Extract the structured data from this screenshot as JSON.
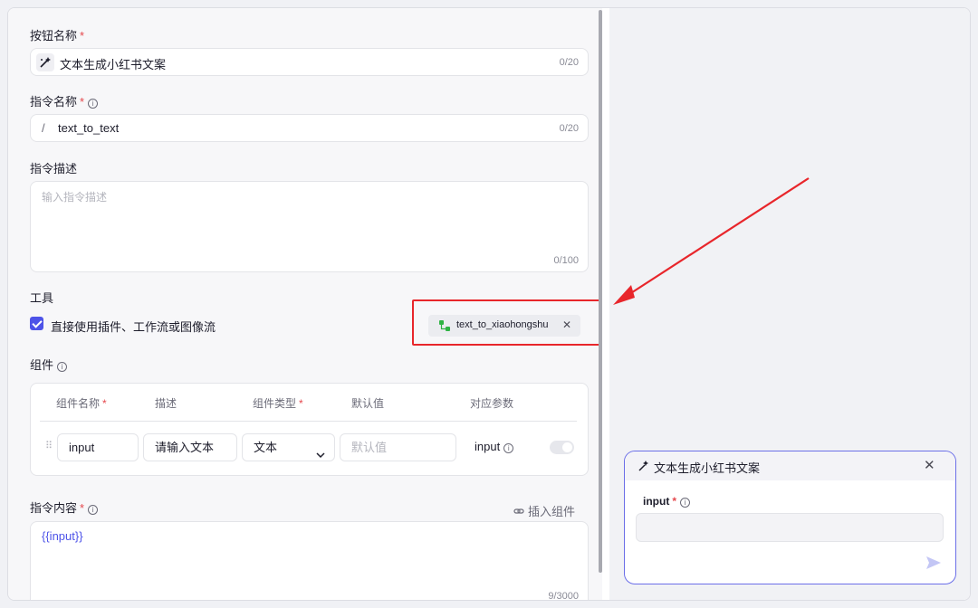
{
  "form": {
    "button_name": {
      "label": "按钮名称",
      "required_mark": "*",
      "value": "文本生成小红书文案",
      "counter": "0/20",
      "icon": "magic-wand-icon"
    },
    "command_name": {
      "label": "指令名称",
      "required_mark": "*",
      "info": "i",
      "prefix": "/",
      "value": "text_to_text",
      "counter": "0/20"
    },
    "command_desc": {
      "label": "指令描述",
      "placeholder": "输入指令描述",
      "counter": "0/100"
    },
    "tools": {
      "label": "工具",
      "checkbox_label": "直接使用插件、工作流或图像流",
      "checked": true,
      "chip_label": "text_to_xiaohongshu",
      "chip_icon": "workflow-icon",
      "chip_close": "✕"
    },
    "components": {
      "label": "组件",
      "info": "i",
      "headers": [
        "组件名称",
        "描述",
        "组件类型",
        "默认值",
        "对应参数"
      ],
      "required_mark": "*",
      "row": {
        "drag_handle": "⠿",
        "name": "input",
        "description": "请输入文本",
        "type": "文本",
        "default_placeholder": "默认值",
        "param": "input",
        "info": "i"
      }
    },
    "command_content": {
      "label": "指令内容",
      "required_mark": "*",
      "info": "i",
      "insert_label": "插入组件",
      "value": "{{input}}",
      "counter": "9/3000"
    }
  },
  "preview": {
    "title": "文本生成小红书文案",
    "close": "✕",
    "field_label": "input",
    "required_mark": "*",
    "info": "i",
    "send_icon": "send-icon"
  },
  "colors": {
    "accent": "#4d53e8",
    "highlight": "#e8262b",
    "required": "#e5484d",
    "dialog_border": "#6b6fe8"
  }
}
